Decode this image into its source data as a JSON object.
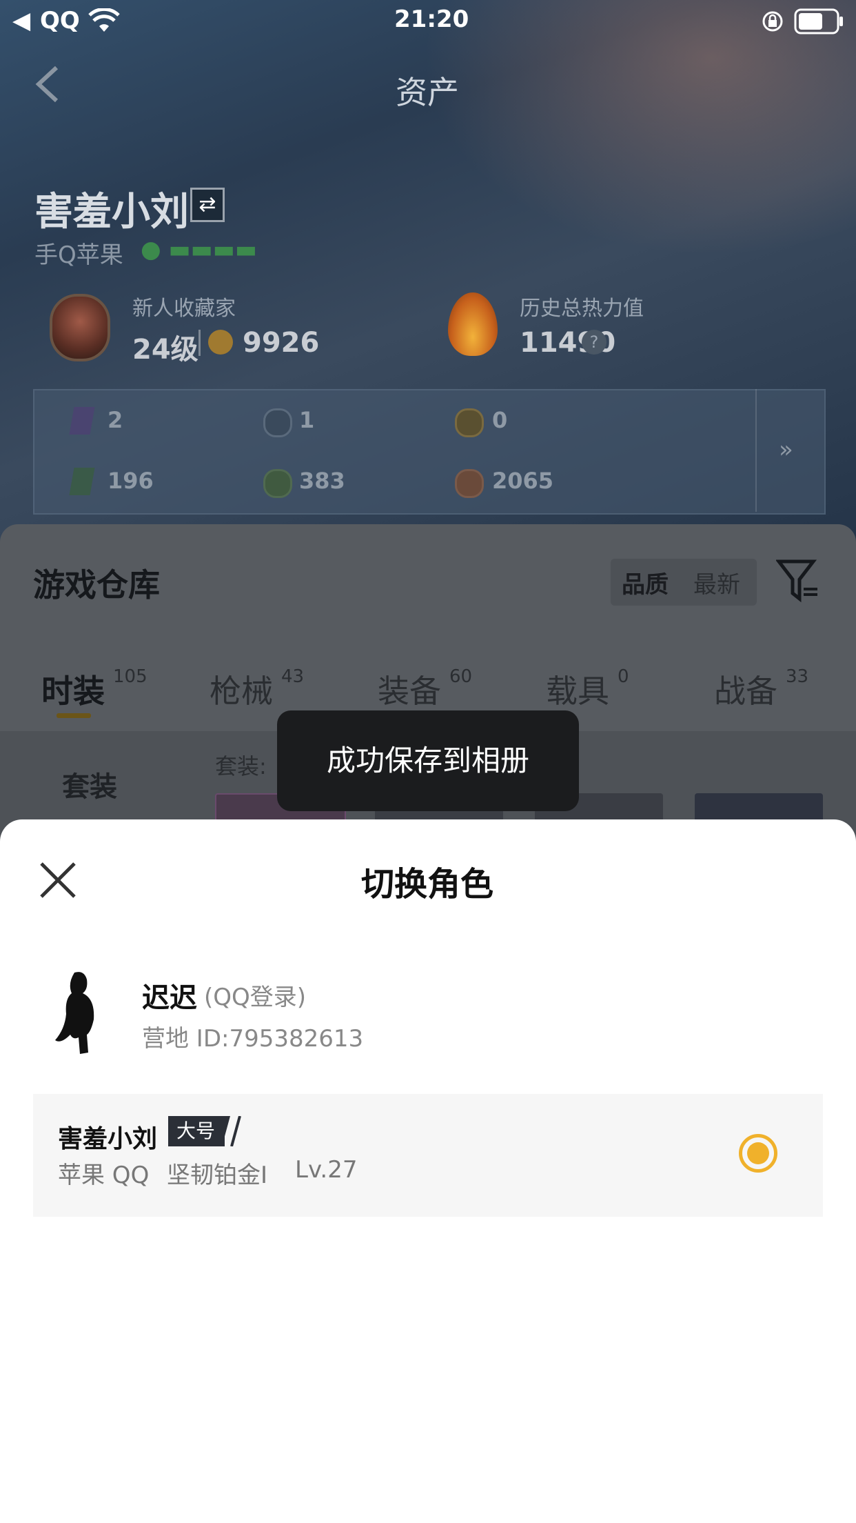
{
  "status_bar": {
    "back_app": "QQ",
    "time": "21:20"
  },
  "nav": {
    "title": "资产"
  },
  "profile": {
    "name": "害羞小刘",
    "swap_symbol": "⇄",
    "platform": "手Q苹果",
    "collector": {
      "label": "新人收藏家",
      "level": "24级",
      "points": "9926"
    },
    "heat": {
      "label": "历史总热力值",
      "value": "11490",
      "help": "?"
    }
  },
  "inventory": {
    "row1": [
      "2",
      "1",
      "0"
    ],
    "row2": [
      "196",
      "383",
      "2065"
    ],
    "more": "»"
  },
  "warehouse": {
    "title": "游戏仓库",
    "sort": {
      "quality": "品质",
      "latest": "最新"
    },
    "tabs": [
      {
        "label": "时装",
        "count": "105"
      },
      {
        "label": "枪械",
        "count": "43"
      },
      {
        "label": "装备",
        "count": "60"
      },
      {
        "label": "载具",
        "count": "0"
      },
      {
        "label": "战备",
        "count": "33"
      }
    ],
    "side_label": "套装",
    "suit_label": "套装:"
  },
  "toast": {
    "text": "成功保存到相册"
  },
  "sheet": {
    "title": "切换角色",
    "account": {
      "name": "迟迟",
      "login_type": "(QQ登录)",
      "camp_id": "营地 ID:795382613"
    },
    "role": {
      "name": "害羞小刘",
      "badge": "大号",
      "platform": "苹果 QQ",
      "rank": "坚韧铂金Ⅰ",
      "level": "Lv.27",
      "selected": true
    }
  },
  "colors": {
    "accent": "#f0b12b",
    "toast_bg": "#1b1c1e"
  }
}
